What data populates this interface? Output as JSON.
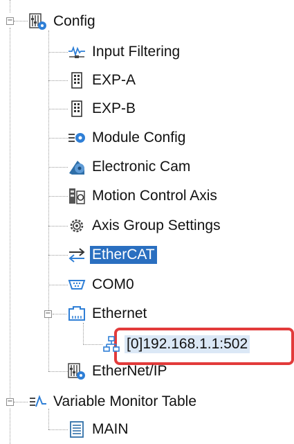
{
  "tree": {
    "root": {
      "label": "Config",
      "expander": "−"
    },
    "items": [
      {
        "label": "Input Filtering",
        "icon": "waveform-icon"
      },
      {
        "label": "EXP-A",
        "icon": "module-card-icon"
      },
      {
        "label": "EXP-B",
        "icon": "module-card-icon"
      },
      {
        "label": "Module Config",
        "icon": "module-config-icon"
      },
      {
        "label": "Electronic Cam",
        "icon": "cam-icon"
      },
      {
        "label": "Motion Control Axis",
        "icon": "axis-icon"
      },
      {
        "label": "Axis Group Settings",
        "icon": "gear-icon"
      },
      {
        "label": "EtherCAT",
        "icon": "transfer-arrows-icon",
        "selected": true
      },
      {
        "label": "COM0",
        "icon": "serial-port-icon"
      },
      {
        "label": "Ethernet",
        "icon": "network-port-icon",
        "expander": "−"
      },
      {
        "label": "[0]192.168.1.1:502",
        "icon": "network-nodes-icon"
      },
      {
        "label": "EtherNet/IP",
        "icon": "config-settings-icon"
      }
    ],
    "root2": {
      "label": "Variable Monitor Table",
      "icon": "monitor-trend-icon",
      "expander": "−"
    },
    "root2_items": [
      {
        "label": "MAIN",
        "icon": "table-doc-icon"
      }
    ]
  },
  "colors": {
    "selection": "#2a6fc0",
    "highlight_border": "#e23b3b",
    "highlight_fill": "#dbe8f6"
  }
}
